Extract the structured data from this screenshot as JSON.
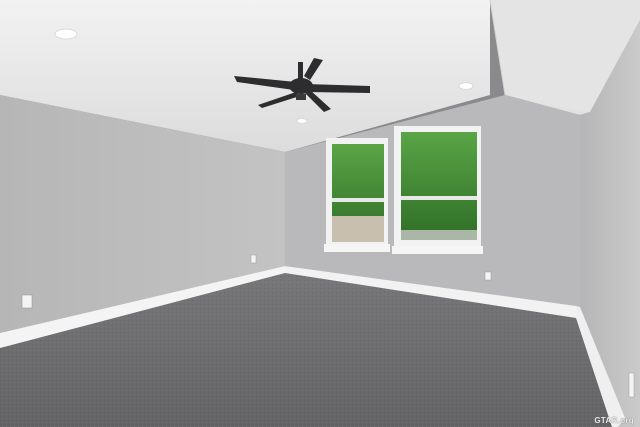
{
  "scene": {
    "description_type": "photo",
    "colors": {
      "ceiling": "#ececec",
      "left_wall": "#bdbdbd",
      "back_wall": "#b8b8ba",
      "right_wall": "#c2c2c4",
      "carpet": "#6f6f71",
      "trim": "#f4f4f4",
      "foliage": "#3f8a34",
      "fan": "#2d2d2f"
    }
  },
  "watermark": {
    "text": "GTAR.org"
  }
}
